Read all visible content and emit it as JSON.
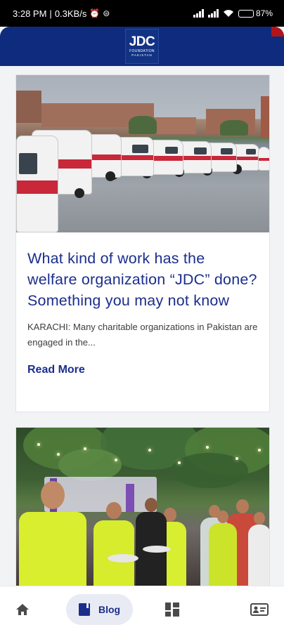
{
  "status_bar": {
    "time": "3:28 PM",
    "speed": "0.3KB/s",
    "battery": "87"
  },
  "header": {
    "logo_main": "JDC",
    "logo_sub": "FOUNDATION",
    "logo_country": "PAKISTAN"
  },
  "posts": [
    {
      "title": "What kind of work has the welfare organization “JDC” done? Something you may not know",
      "excerpt": "KARACHI: Many charitable organizations in Pakistan are engaged in the...",
      "read_more": "Read More"
    }
  ],
  "bottom_nav": {
    "items": [
      {
        "icon": "home-icon",
        "label": ""
      },
      {
        "icon": "book-icon",
        "label": "Blog",
        "active": true
      },
      {
        "icon": "grid-icon",
        "label": ""
      },
      {
        "icon": "contact-card-icon",
        "label": ""
      }
    ]
  },
  "colors": {
    "brand_blue": "#0e2b7e",
    "title_blue": "#1b2e8c",
    "accent_red": "#b3141c"
  }
}
